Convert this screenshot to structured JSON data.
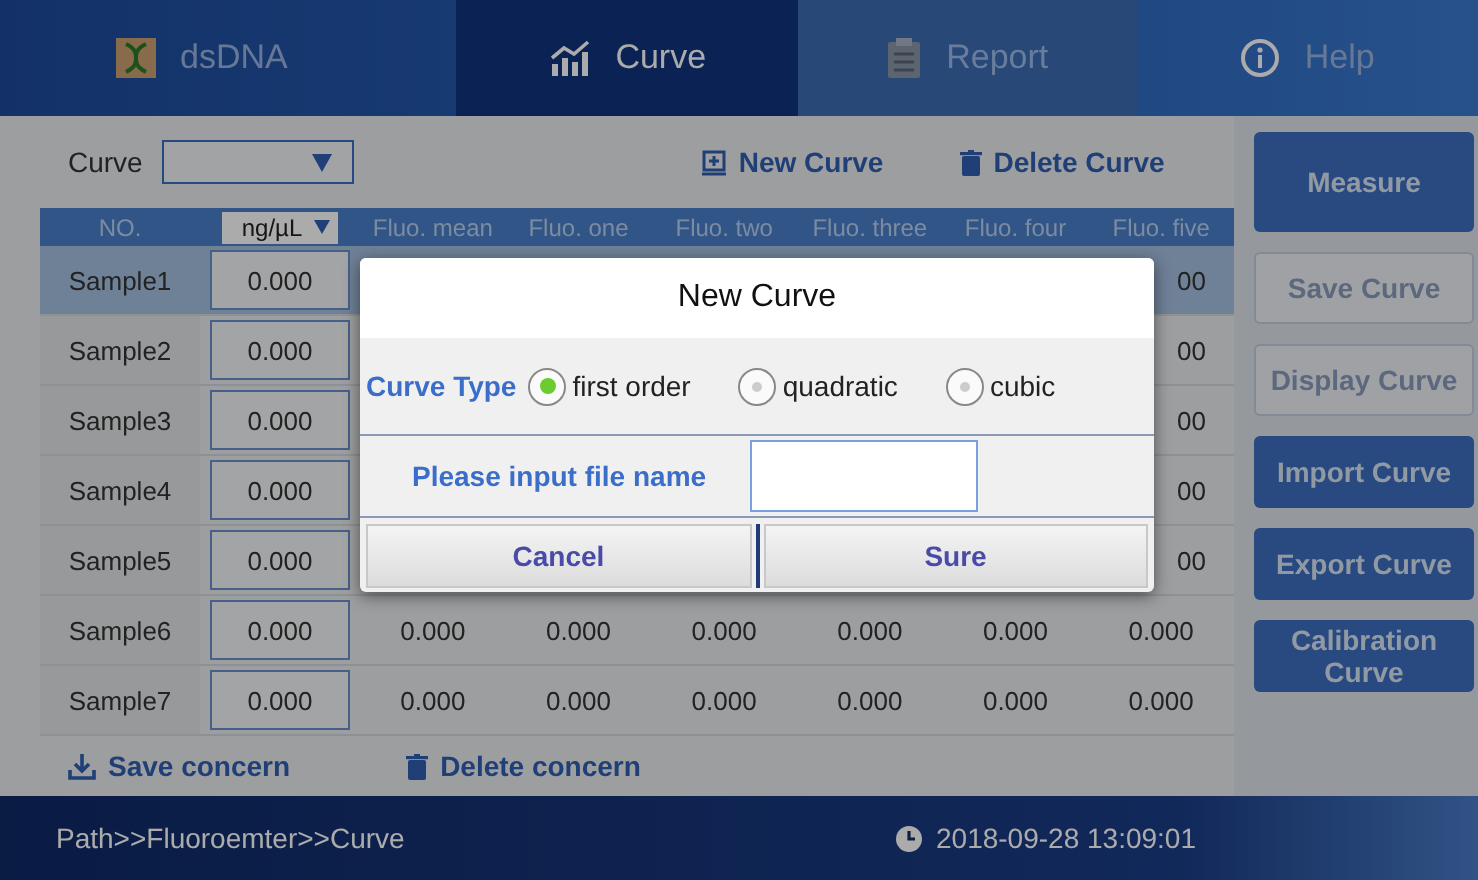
{
  "tabs": [
    {
      "label": "dsDNA",
      "selected": false,
      "disabled": false
    },
    {
      "label": "Curve",
      "selected": true,
      "disabled": false
    },
    {
      "label": "Report",
      "selected": false,
      "disabled": true
    },
    {
      "label": "Help",
      "selected": false,
      "disabled": false
    }
  ],
  "curve_bar": {
    "label": "Curve",
    "actions": [
      "New Curve",
      "Delete Curve"
    ]
  },
  "table": {
    "columns": [
      "NO.",
      "Fluo. mean",
      "Fluo. one",
      "Fluo. two",
      "Fluo. three",
      "Fluo. four",
      "Fluo. five"
    ],
    "unit": "ng/µL",
    "rows": [
      {
        "no": "Sample1",
        "concentration": "0.000",
        "values": [
          "00"
        ],
        "selected": true
      },
      {
        "no": "Sample2",
        "concentration": "0.000",
        "values": [
          "00"
        ],
        "selected": false
      },
      {
        "no": "Sample3",
        "concentration": "0.000",
        "values": [
          "00"
        ],
        "selected": false
      },
      {
        "no": "Sample4",
        "concentration": "0.000",
        "values": [
          "00"
        ],
        "selected": false
      },
      {
        "no": "Sample5",
        "concentration": "0.000",
        "values": [
          "00"
        ],
        "selected": false
      },
      {
        "no": "Sample6",
        "concentration": "0.000",
        "values": [
          "0.000",
          "0.000",
          "0.000",
          "0.000",
          "0.000",
          "0.000"
        ],
        "selected": false
      },
      {
        "no": "Sample7",
        "concentration": "0.000",
        "values": [
          "0.000",
          "0.000",
          "0.000",
          "0.000",
          "0.000",
          "0.000"
        ],
        "selected": false
      }
    ]
  },
  "bottom_actions": [
    "Save concern",
    "Delete concern"
  ],
  "sidebar": [
    {
      "label": "Measure",
      "disabled": false
    },
    {
      "label": "Save Curve",
      "disabled": true
    },
    {
      "label": "Display Curve",
      "disabled": true
    },
    {
      "label": "Import Curve",
      "disabled": false
    },
    {
      "label": "Export Curve",
      "disabled": false
    },
    {
      "label": "Calibration Curve",
      "disabled": false
    }
  ],
  "status_bar": {
    "path": "Path>>Fluoroemter>>Curve",
    "datetime": "2018-09-28 13:09:01"
  },
  "dialog": {
    "title": "New Curve",
    "curve_type_label": "Curve Type",
    "curve_types": [
      {
        "label": "first order",
        "selected": true
      },
      {
        "label": "quadratic",
        "selected": false
      },
      {
        "label": "cubic",
        "selected": false
      }
    ],
    "file_name_label": "Please input file name",
    "buttons": [
      "Cancel",
      "Sure"
    ]
  }
}
